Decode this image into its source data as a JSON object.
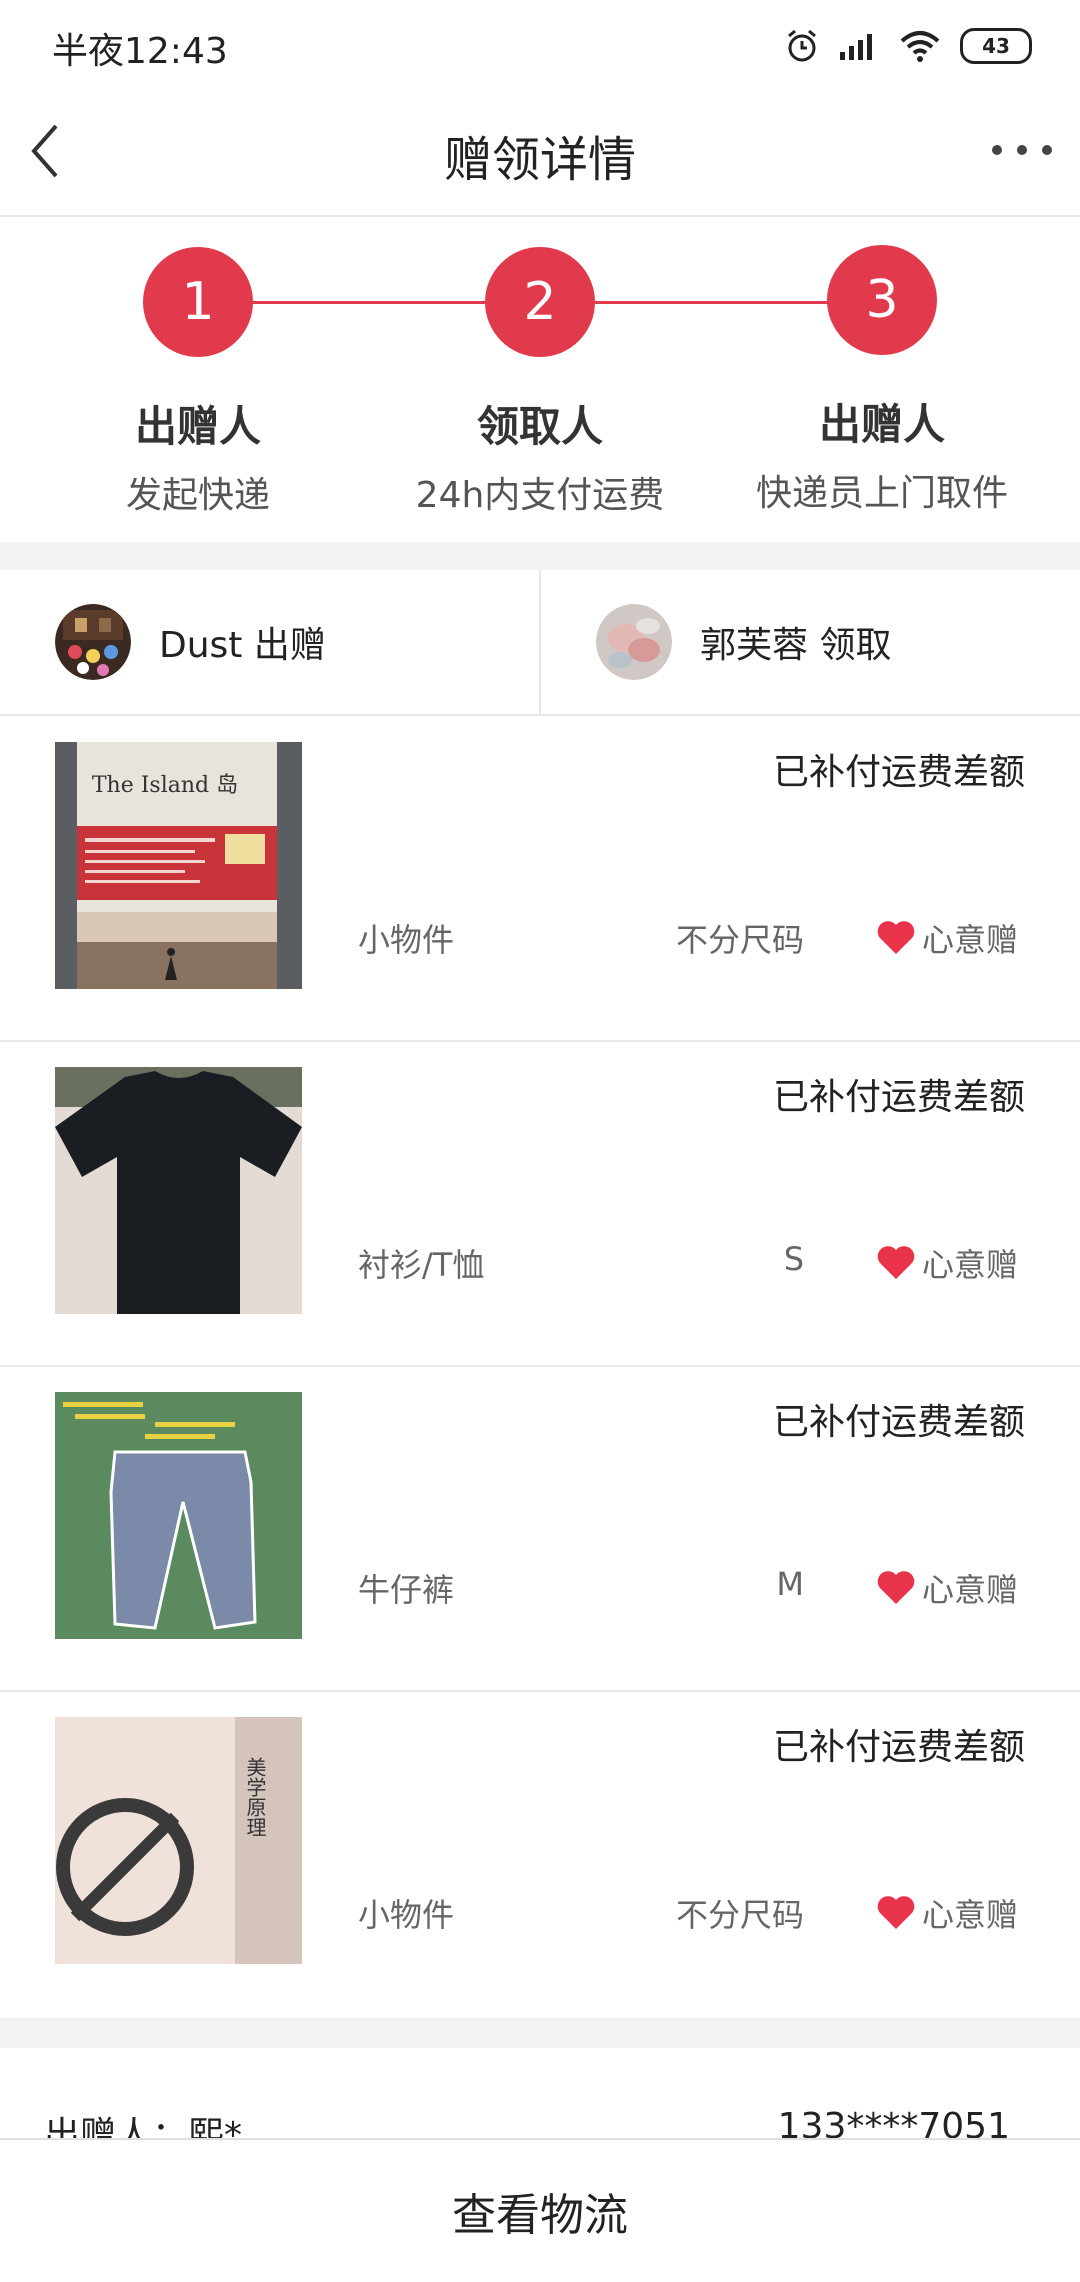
{
  "status_bar": {
    "time": "半夜12:43",
    "battery": "43"
  },
  "header": {
    "title": "赠领详情"
  },
  "steps": [
    {
      "number": "1",
      "role": "出赠人",
      "desc": "发起快递"
    },
    {
      "number": "2",
      "role": "领取人",
      "desc": "24h内支付运费"
    },
    {
      "number": "3",
      "role": "出赠人",
      "desc": "快递员上门取件"
    }
  ],
  "users": {
    "giver": "Dust 出赠",
    "receiver": "郭芙蓉 领取"
  },
  "items": [
    {
      "status": "已补付运费差额",
      "category": "小物件",
      "size": "不分尺码",
      "tag": "心意赠",
      "thumb_icon": "book-island-photo",
      "title_text": "The Island 岛"
    },
    {
      "status": "已补付运费差额",
      "category": "衬衫/T恤",
      "size": "S",
      "tag": "心意赠",
      "thumb_icon": "black-tshirt-photo"
    },
    {
      "status": "已补付运费差额",
      "category": "牛仔裤",
      "size": "M",
      "tag": "心意赠",
      "thumb_icon": "jeans-photo"
    },
    {
      "status": "已补付运费差额",
      "category": "小物件",
      "size": "不分尺码",
      "tag": "心意赠",
      "thumb_icon": "book-aesthetics-photo",
      "title_text": "美学原理"
    }
  ],
  "contact": {
    "name": "出赠人：熙*",
    "phone": "133****7051"
  },
  "bottom": {
    "button_label": "查看物流"
  },
  "colors": {
    "accent": "#e23a4d",
    "heart": "#e8334a"
  }
}
